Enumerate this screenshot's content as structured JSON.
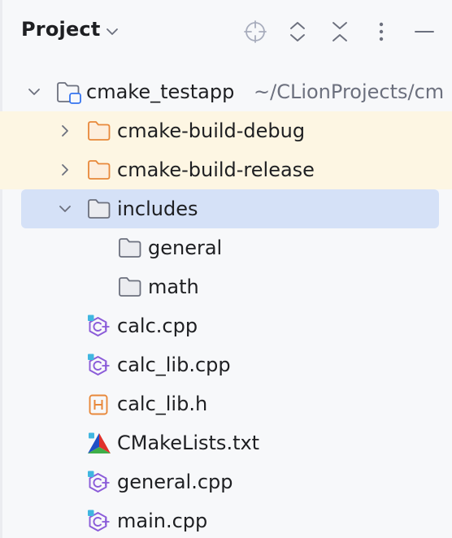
{
  "panel": {
    "title": "Project"
  },
  "tree": {
    "root": {
      "label": "cmake_testapp",
      "path": "~/CLionProjects/cm"
    },
    "items": [
      {
        "label": "cmake-build-debug",
        "type": "folder-excluded",
        "expanded": false
      },
      {
        "label": "cmake-build-release",
        "type": "folder-excluded",
        "expanded": false
      },
      {
        "label": "includes",
        "type": "folder",
        "expanded": true,
        "selected": true
      },
      {
        "label": "general",
        "type": "folder"
      },
      {
        "label": "math",
        "type": "folder"
      },
      {
        "label": "calc.cpp",
        "type": "cpp-file"
      },
      {
        "label": "calc_lib.cpp",
        "type": "cpp-file"
      },
      {
        "label": "calc_lib.h",
        "type": "header-file"
      },
      {
        "label": "CMakeLists.txt",
        "type": "cmake-file"
      },
      {
        "label": "general.cpp",
        "type": "cpp-file"
      },
      {
        "label": "main.cpp",
        "type": "cpp-file"
      }
    ]
  },
  "icons": {
    "title_dropdown": "chevron-down-icon",
    "locate": "crosshair-icon",
    "expand_all": "expand-all-icon",
    "collapse_all": "collapse-all-icon",
    "options": "more-vertical-icon",
    "hide": "minimize-icon"
  },
  "colors": {
    "background": "#f7f8fa",
    "selection": "#d5e1f7",
    "excluded_row": "#fdf6e3",
    "excluded_folder": "#e8883a",
    "folder_outline": "#6c707e",
    "cpp_icon": "#8b5cd9",
    "module_badge": "#3574f0",
    "hint_text": "#6c707e"
  }
}
